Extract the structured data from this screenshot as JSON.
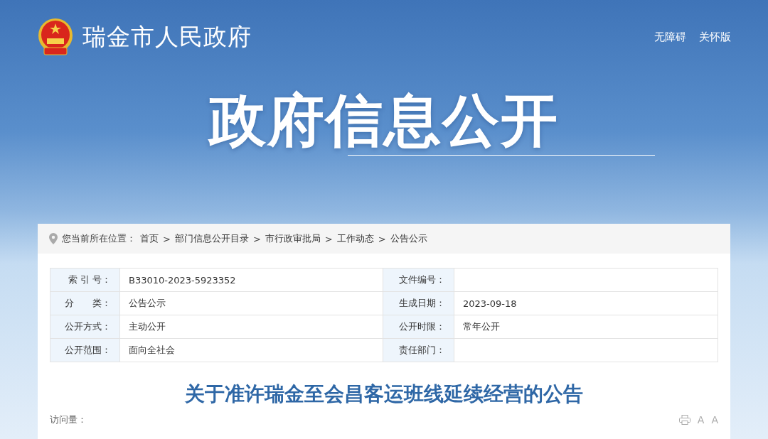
{
  "header": {
    "site_name": "瑞金市人民政府",
    "links": [
      "无障碍",
      "关怀版"
    ],
    "banner_title": "政府信息公开"
  },
  "breadcrumb": {
    "prefix": "您当前所在位置：",
    "items": [
      "首页",
      "部门信息公开目录",
      "市行政审批局",
      "工作动态",
      "公告公示"
    ],
    "separator": ">"
  },
  "info_table": [
    {
      "label": "索 引 号：",
      "value": "B33010-2023-5923352",
      "label_2": "文件编号："
    },
    {
      "label": "分　　类：",
      "value": "公告公示",
      "label_2": "生成日期：",
      "value_2": "2023-09-18"
    },
    {
      "label": "公开方式：",
      "value": "主动公开",
      "label_2": "公开时限：",
      "value_2": "常年公开"
    },
    {
      "label": "公开范围：",
      "value": "面向全社会",
      "label_2": "责任部门："
    }
  ],
  "article": {
    "title": "关于准许瑞金至会昌客运班线延续经营的公告",
    "views_label": "访问量：",
    "font_buttons": [
      "A",
      "A"
    ]
  }
}
